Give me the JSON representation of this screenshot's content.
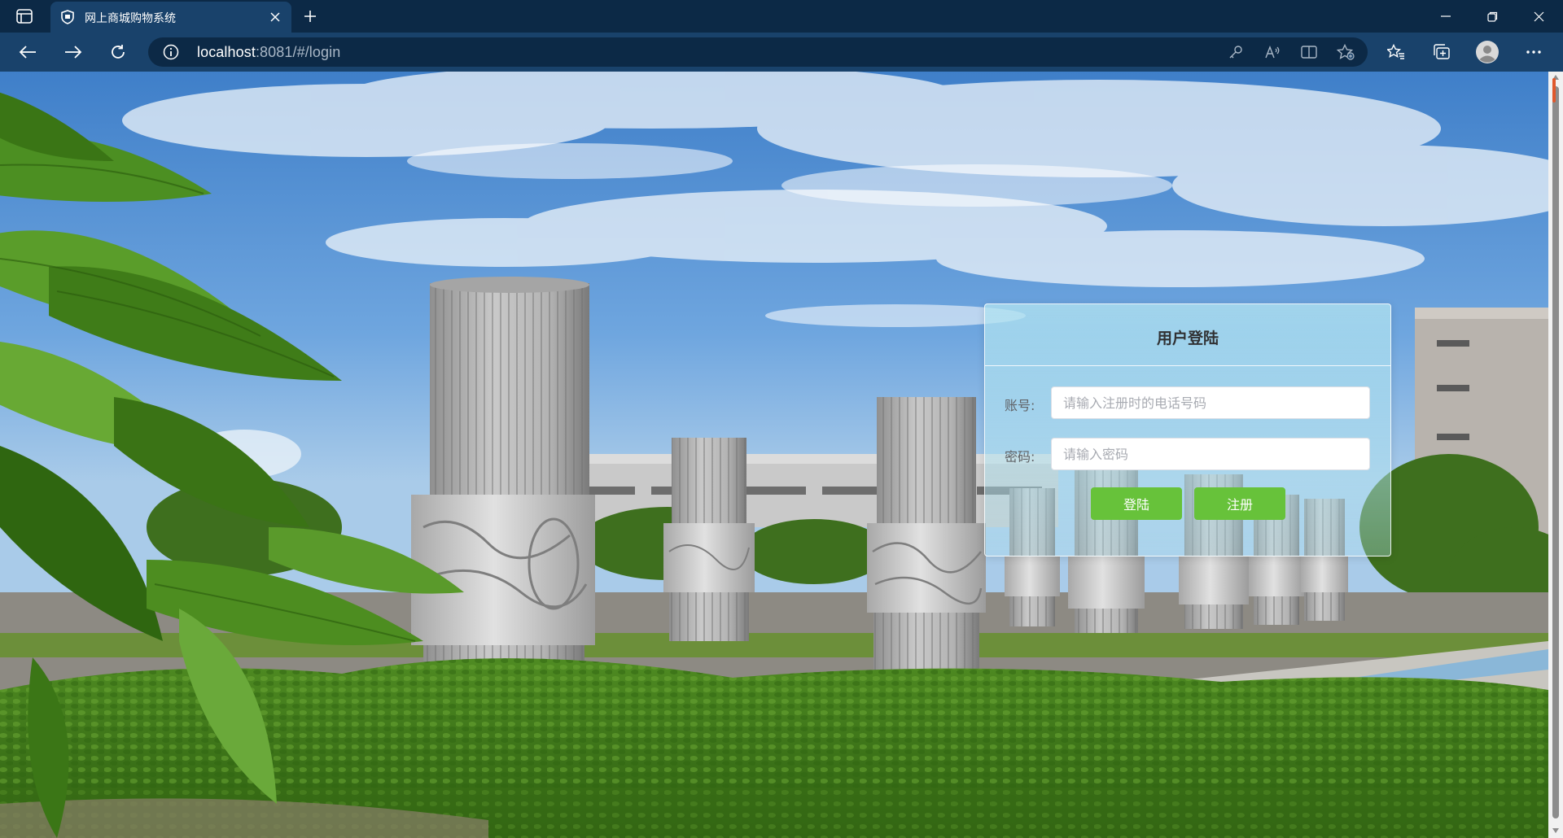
{
  "browser": {
    "tab_title": "网上商城购物系统",
    "url_host": "localhost",
    "url_rest": ":8081/#/login"
  },
  "login": {
    "title": "用户登陆",
    "account_label": "账号:",
    "account_placeholder": "请输入注册时的电话号码",
    "password_label": "密码:",
    "password_placeholder": "请输入密码",
    "login_button": "登陆",
    "register_button": "注册"
  },
  "colors": {
    "browser_dark": "#0c2946",
    "browser_bar": "#19426b",
    "button_green": "#67c23a",
    "card_tint": "#b0e2f0"
  }
}
